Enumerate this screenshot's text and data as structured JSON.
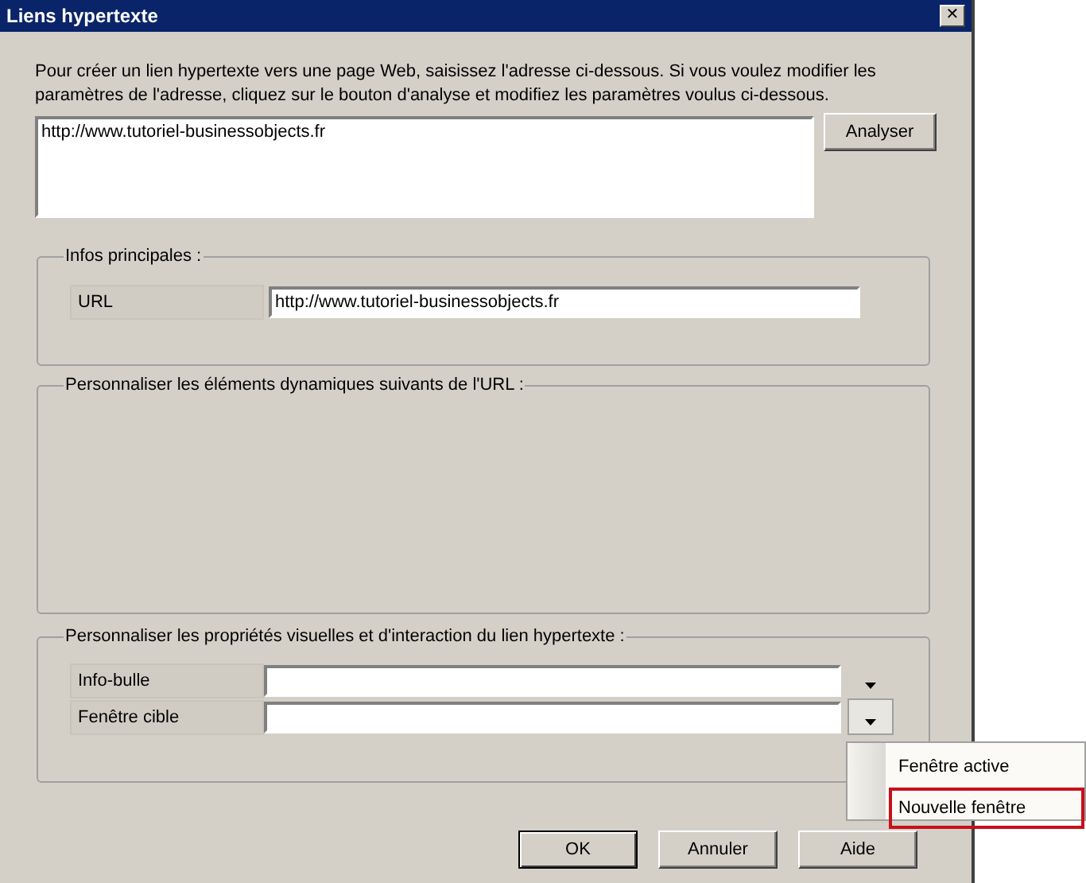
{
  "window": {
    "title": "Liens hypertexte",
    "close": "✕"
  },
  "description": "Pour créer un lien hypertexte vers une page Web, saisissez l'adresse ci-dessous. Si vous voulez modifier les paramètres de l'adresse, cliquez sur le bouton d'analyse et modifiez les paramètres voulus ci-dessous.",
  "address": {
    "value": "http://www.tutoriel-businessobjects.fr"
  },
  "analyze_button": "Analyser",
  "main_info": {
    "legend": "Infos principales :",
    "rows": [
      {
        "label": "URL",
        "value": "http://www.tutoriel-businessobjects.fr"
      }
    ]
  },
  "dynamic": {
    "legend": "Personnaliser les éléments dynamiques suivants de l'URL :"
  },
  "visual": {
    "legend": "Personnaliser les propriétés visuelles et d'interaction du lien hypertexte :",
    "rows": [
      {
        "label": "Info-bulle",
        "pressed": false
      },
      {
        "label": "Fenêtre cible",
        "pressed": true
      }
    ]
  },
  "dropdown_menu": [
    {
      "label": "Fenêtre active",
      "selected": false
    },
    {
      "label": "Nouvelle fenêtre",
      "selected": true
    }
  ],
  "buttons": [
    {
      "label": "OK",
      "default": true
    },
    {
      "label": "Annuler",
      "default": false
    },
    {
      "label": "Aide",
      "default": false
    }
  ]
}
